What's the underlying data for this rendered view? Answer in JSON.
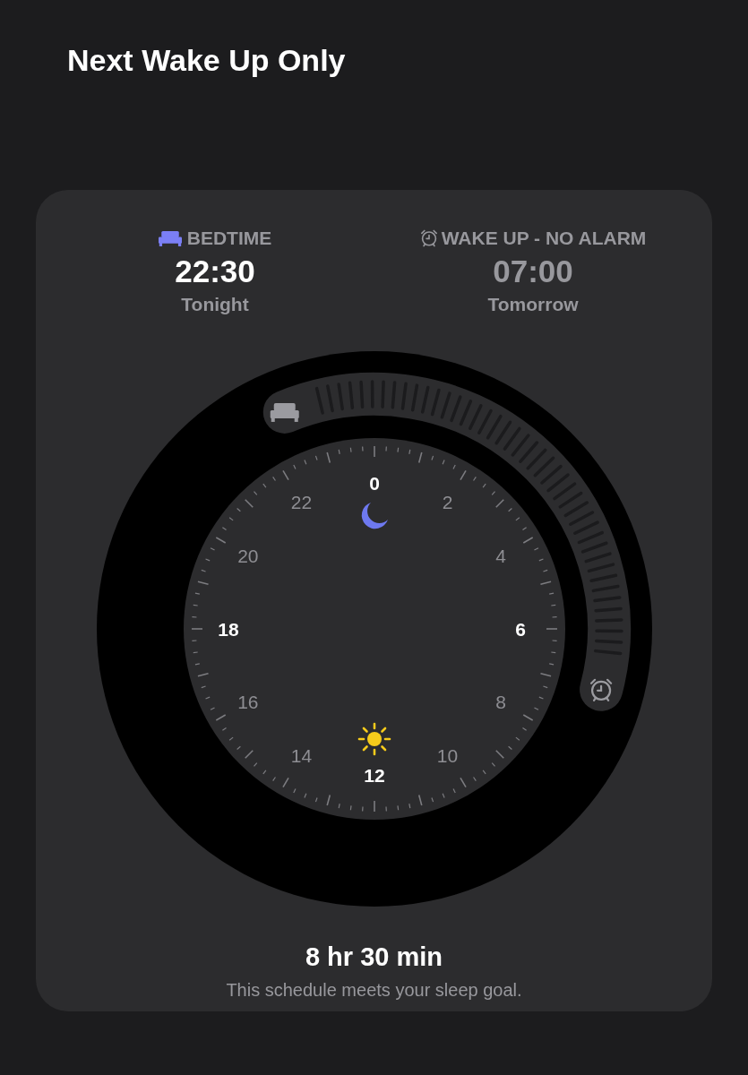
{
  "title": "Next Wake Up Only",
  "bedtime": {
    "label": "BEDTIME",
    "time": "22:30",
    "day": "Tonight"
  },
  "wake_up": {
    "label": "WAKE UP - NO ALARM",
    "time": "07:00",
    "day": "Tomorrow",
    "alarm_on": false
  },
  "dial": {
    "hour_labels": [
      {
        "text": "0",
        "emphasized": true
      },
      {
        "text": "2",
        "emphasized": false
      },
      {
        "text": "4",
        "emphasized": false
      },
      {
        "text": "6",
        "emphasized": true
      },
      {
        "text": "8",
        "emphasized": false
      },
      {
        "text": "10",
        "emphasized": false
      },
      {
        "text": "12",
        "emphasized": true
      },
      {
        "text": "14",
        "emphasized": false
      },
      {
        "text": "16",
        "emphasized": false
      },
      {
        "text": "18",
        "emphasized": true
      },
      {
        "text": "20",
        "emphasized": false
      },
      {
        "text": "22",
        "emphasized": false
      }
    ]
  },
  "summary": {
    "duration": "8 hr 30 min",
    "note": "This schedule meets your sleep goal."
  }
}
